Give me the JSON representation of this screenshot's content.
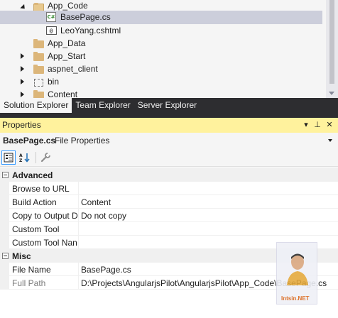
{
  "solution_explorer": {
    "items": [
      {
        "label": "App_Code",
        "icon": "folder-open-icon",
        "expander": "expanded"
      },
      {
        "label": "BasePage.cs",
        "icon": "csharp-file-icon",
        "expander": "none",
        "selected": true
      },
      {
        "label": "LeoYang.cshtml",
        "icon": "razor-file-icon",
        "expander": "none"
      },
      {
        "label": "App_Data",
        "icon": "folder-icon",
        "expander": "none"
      },
      {
        "label": "App_Start",
        "icon": "folder-icon",
        "expander": "collapsed"
      },
      {
        "label": "aspnet_client",
        "icon": "folder-icon",
        "expander": "collapsed"
      },
      {
        "label": "bin",
        "icon": "excluded-folder-icon",
        "expander": "collapsed"
      },
      {
        "label": "Content",
        "icon": "folder-icon",
        "expander": "collapsed"
      }
    ],
    "icon_glyphs": {
      "csharp": "C#",
      "razor": "@"
    }
  },
  "tabs": [
    {
      "label": "Solution Explorer",
      "active": true
    },
    {
      "label": "Team Explorer",
      "active": false
    },
    {
      "label": "Server Explorer",
      "active": false
    }
  ],
  "properties": {
    "title": "Properties",
    "title_buttons": {
      "dropdown": "▾",
      "pin": "⊥",
      "close": "✕"
    },
    "object_name": "BasePage.cs",
    "object_type": "File Properties",
    "categories": [
      {
        "label": "Advanced",
        "rows": [
          {
            "name": "Browse to URL",
            "value": ""
          },
          {
            "name": "Build Action",
            "value": "Content"
          },
          {
            "name": "Copy to Output D",
            "value": "Do not copy"
          },
          {
            "name": "Custom Tool",
            "value": ""
          },
          {
            "name": "Custom Tool Nan",
            "value": ""
          }
        ]
      },
      {
        "label": "Misc",
        "rows": [
          {
            "name": "File Name",
            "value": "BasePage.cs"
          },
          {
            "name": "Full Path",
            "value": "D:\\Projects\\AngularjsPilot\\AngularjsPilot\\App_Code\\BasePage.cs",
            "readonly": true
          }
        ]
      }
    ]
  },
  "watermark": {
    "text": "Intsin.NET"
  },
  "colors": {
    "title_bar": "#fff29d",
    "tab_strip": "#2d2d30",
    "selection": "#cccedb",
    "folder": "#dcb67a"
  }
}
